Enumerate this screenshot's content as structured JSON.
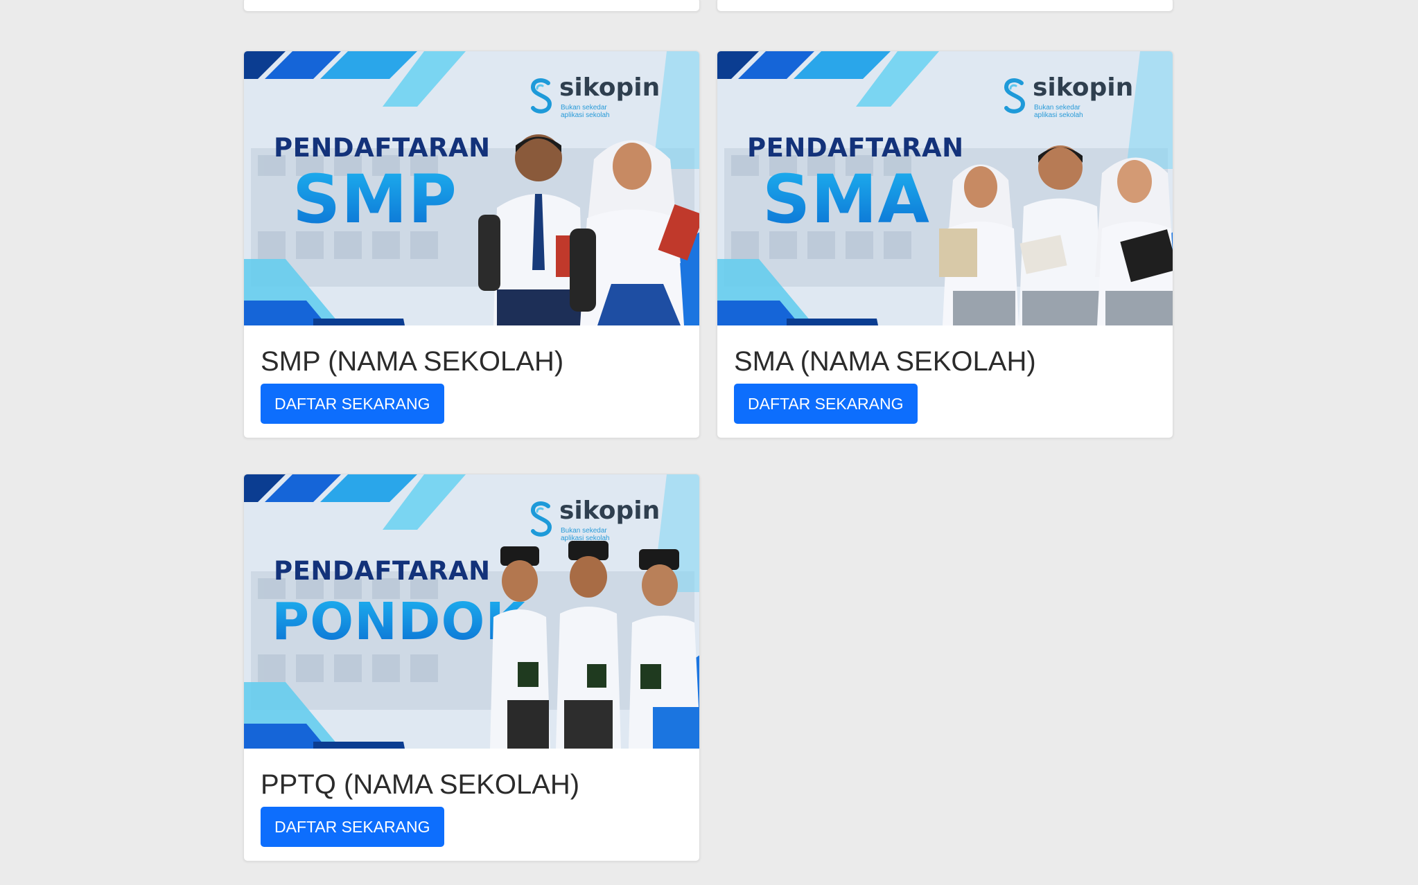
{
  "colors": {
    "page_background": "#ebebeb",
    "button": "#0d6efd",
    "banner_heading": "#13327a",
    "banner_title": "#1689e6",
    "logo_text": "#2f3f4f"
  },
  "cards": [
    {
      "banner": {
        "logo_text": "sikopin",
        "logo_tagline": "Bukan sekedar aplikasi sekolah",
        "kicker": "PENDAFTARAN",
        "title": "SMP"
      },
      "title": "SMP (NAMA SEKOLAH)",
      "button_label": "DAFTAR SEKARANG"
    },
    {
      "banner": {
        "logo_text": "sikopin",
        "logo_tagline": "Bukan sekedar aplikasi sekolah",
        "kicker": "PENDAFTARAN",
        "title": "SMA"
      },
      "title": "SMA (NAMA SEKOLAH)",
      "button_label": "DAFTAR SEKARANG"
    },
    {
      "banner": {
        "logo_text": "sikopin",
        "logo_tagline": "Bukan sekedar aplikasi sekolah",
        "kicker": "PENDAFTARAN",
        "title": "PONDOK"
      },
      "title": "PPTQ (NAMA SEKOLAH)",
      "button_label": "DAFTAR SEKARANG"
    }
  ]
}
